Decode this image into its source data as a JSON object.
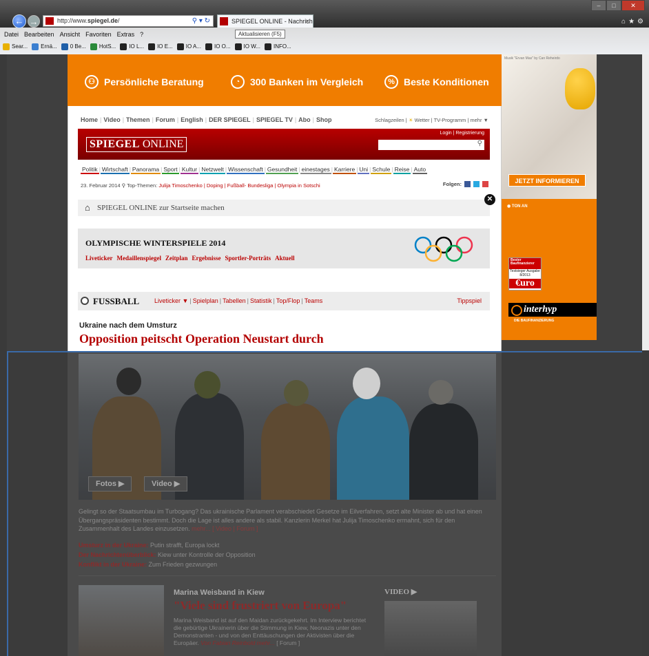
{
  "browser": {
    "url": "http://www.spiegel.de/",
    "url_display_prefix": "http://www.",
    "url_display_domain": "spiegel.de",
    "url_display_suffix": "/",
    "tab_title": "SPIEGEL ONLINE - Nachrich...",
    "tooltip": "Aktualisieren (F5)",
    "menu": [
      "Datei",
      "Bearbeiten",
      "Ansicht",
      "Favoriten",
      "Extras",
      "?"
    ],
    "favorites": [
      "Sear...",
      "Ernä...",
      "0 Be...",
      "HotS...",
      "IO L...",
      "IO E...",
      "IO A...",
      "IO O...",
      "IO W...",
      "INFO..."
    ]
  },
  "banner": {
    "items": [
      "Persönliche Beratung",
      "300 Banken im Vergleich",
      "Beste Konditionen"
    ]
  },
  "site": {
    "topnav": [
      "Home",
      "Video",
      "Themen",
      "Forum",
      "English",
      "DER SPIEGEL",
      "SPIEGEL TV",
      "Abo",
      "Shop"
    ],
    "rightnav": {
      "schlagzeilen": "Schlagzeilen",
      "wetter": "Wetter",
      "tv": "TV-Programm",
      "mehr": "mehr ▼"
    },
    "logo_bold": "SPIEGEL",
    "logo_rest": " ONLINE",
    "login": "Login | Registrierung",
    "categories": [
      "Politik",
      "Wirtschaft",
      "Panorama",
      "Sport",
      "Kultur",
      "Netzwelt",
      "Wissenschaft",
      "Gesundheit",
      "einestages",
      "Karriere",
      "Uni",
      "Schule",
      "Reise",
      "Auto"
    ],
    "date": "23. Februar 2014",
    "top_themen_label": "Top-Themen:",
    "top_themen": "Julija Timoschenko | Doping | Fußball- Bundesliga | Olympia in Sotschi",
    "folgen": "Folgen:",
    "startseite": "SPIEGEL ONLINE zur Startseite machen",
    "olympics": {
      "title": "OLYMPISCHE WINTERSPIELE 2014",
      "links": [
        "Liveticker",
        "Medaillenspiegel",
        "Zeitplan",
        "Ergebnisse",
        "Sportler-Porträts",
        "Aktuell"
      ]
    },
    "fussball": {
      "title": "FUSSBALL",
      "links": [
        "Liveticker ▼",
        "Spielplan",
        "Tabellen",
        "Statistik",
        "Top/Flop",
        "Teams"
      ],
      "tippspiel": "Tippspiel"
    },
    "article": {
      "kicker": "Ukraine nach dem Umsturz",
      "headline": "Opposition peitscht Operation Neustart durch",
      "fotos": "Fotos ▶",
      "video": "Video ▶",
      "lead": "Gelingt so der Staatsumbau im Turbogang? Das ukrainische Parlament verabschiedet Gesetze im Eilverfahren, setzt alte Minister ab und hat einen Übergangspräsidenten bestimmt. Doch die Lage ist alles andere als stabil. Kanzlerin Merkel hat Julija Timoschenko ermahnt, sich für den Zusammenhalt des Landes einzusetzen.",
      "lead_more": "mehr... [ Video | Forum ]",
      "related": [
        {
          "bold": "Umsturz in der Ukraine:",
          "text": " Putin strafft, Europa lockt"
        },
        {
          "bold": "Der Nachrichtenüberblick:",
          "text": " Kiew unter Kontrolle der Opposition"
        },
        {
          "bold": "Konflikt in der Ukraine:",
          "text": " Zum Frieden gezwungen"
        }
      ]
    },
    "second": {
      "kicker": "Marina Weisband in Kiew",
      "headline": "\"Viele sind frustriert von Europa\"",
      "text": "Marina Weisband ist auf den Maidan zurückgekehrt. Im Interview berichtet die gebürtige Ukrainerin über die Stimmung in Kiew, Neonazis unter den Demonstranten - und von den Enttäuschungen der Aktivisten über die Europäer.",
      "byline": "Von Fabian Reinbold mehr...",
      "forum": "[ Forum ]",
      "video_label": "VIDEO ▶"
    }
  },
  "ad": {
    "caption": "Musik \"Ervan Mas\" by Can Reheirdo",
    "cta": "JETZT INFORMIEREN",
    "sound": "TON AN",
    "badge_top": "Bester Baufinanzierer",
    "badge_mid": "Testsieger Ausgabe 8/2013",
    "badge_logo": "€uro",
    "brand": "interhyp",
    "brand_sub": "DIE BAUFINANZIERUNG"
  },
  "colors": {
    "spiegel_red": "#b30000",
    "orange": "#f07d00"
  }
}
